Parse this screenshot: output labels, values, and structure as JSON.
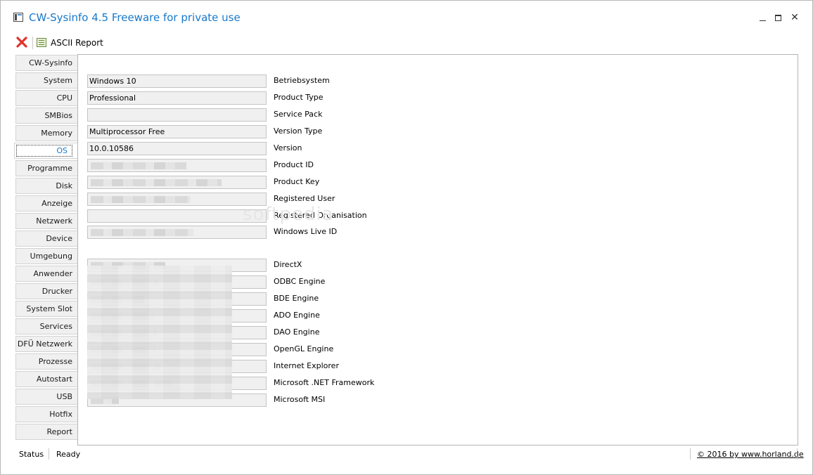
{
  "window": {
    "title": "CW-Sysinfo 4.5 Freeware for private use",
    "accent_color": "#1979ca",
    "controls": {
      "minimize": "—",
      "maximize": "□",
      "close": "✕"
    }
  },
  "toolbar": {
    "close_icon": "red-x-icon",
    "report_label": "ASCII Report"
  },
  "tabs": [
    {
      "label": "CW-Sysinfo"
    },
    {
      "label": "System"
    },
    {
      "label": "CPU"
    },
    {
      "label": "SMBios"
    },
    {
      "label": "Memory"
    },
    {
      "label": "OS",
      "active": true
    },
    {
      "label": "Programme"
    },
    {
      "label": "Disk"
    },
    {
      "label": "Anzeige"
    },
    {
      "label": "Netzwerk"
    },
    {
      "label": "Device"
    },
    {
      "label": "Umgebung"
    },
    {
      "label": "Anwender"
    },
    {
      "label": "Drucker"
    },
    {
      "label": "System Slot"
    },
    {
      "label": "Services"
    },
    {
      "label": "DFÜ Netzwerk"
    },
    {
      "label": "Prozesse"
    },
    {
      "label": "Autostart"
    },
    {
      "label": "USB"
    },
    {
      "label": "Hotfix"
    },
    {
      "label": "Report"
    }
  ],
  "os_fields": [
    {
      "label": "Betriebsystem",
      "value": "Windows 10"
    },
    {
      "label": "Product Type",
      "value": "Professional"
    },
    {
      "label": "Service Pack",
      "value": ""
    },
    {
      "label": "Version Type",
      "value": "Multiprocessor Free"
    },
    {
      "label": "Version",
      "value": "10.0.10586"
    },
    {
      "label": "Product ID",
      "value": "",
      "redacted": true
    },
    {
      "label": "Product Key",
      "value": "",
      "redacted": true
    },
    {
      "label": "Registered User",
      "value": "",
      "redacted": true
    },
    {
      "label": "Registered Organisation",
      "value": ""
    },
    {
      "label": "Windows Live ID",
      "value": "",
      "redacted": true
    }
  ],
  "component_fields": [
    {
      "label": "DirectX",
      "value": "",
      "redacted": true
    },
    {
      "label": "ODBC Engine",
      "value": "",
      "redacted": true
    },
    {
      "label": "BDE Engine",
      "value": "",
      "redacted": true
    },
    {
      "label": "ADO Engine",
      "value": "",
      "redacted": true
    },
    {
      "label": "DAO Engine",
      "value": "",
      "redacted": true
    },
    {
      "label": "OpenGL Engine",
      "value": "",
      "redacted": true
    },
    {
      "label": "Internet Explorer",
      "value": "",
      "redacted": true
    },
    {
      "label": "Microsoft .NET Framework",
      "value": "",
      "redacted": true
    },
    {
      "label": "Microsoft MSI",
      "value": "",
      "redacted": true
    }
  ],
  "watermark": "softpedia",
  "statusbar": {
    "label": "Status",
    "value": "Ready",
    "copyright": "© 2016 by www.horland.de"
  }
}
